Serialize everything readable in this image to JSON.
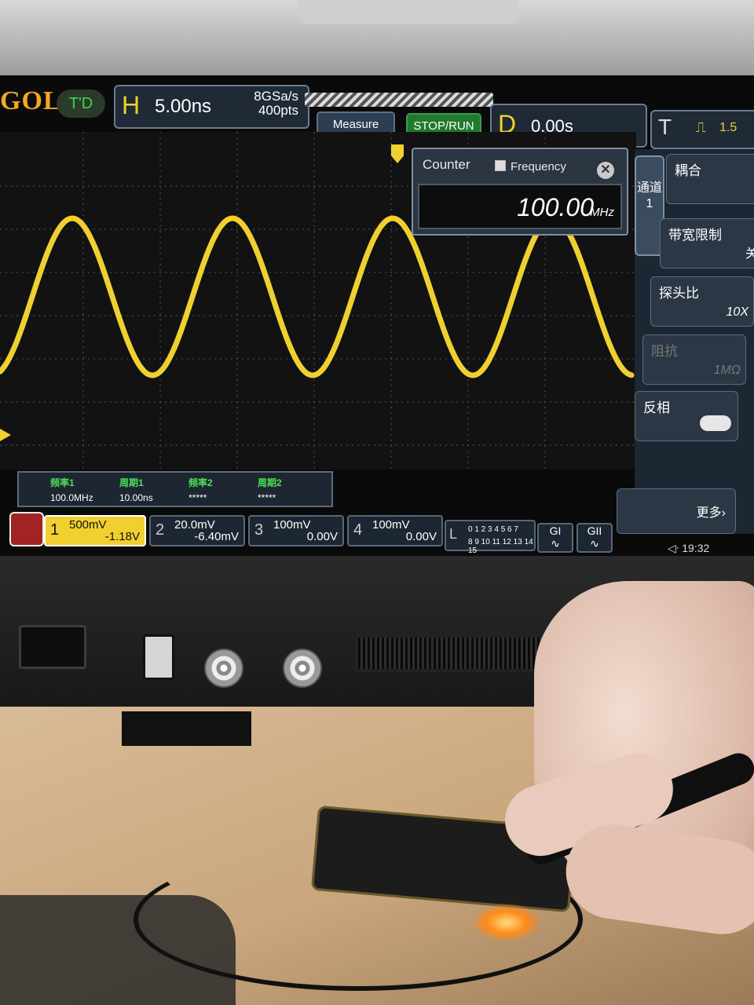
{
  "brand": "GOL",
  "topbar": {
    "td_button": "T'D",
    "horizontal": {
      "letter": "H",
      "timebase": "5.00ns",
      "sample_rate": "8GSa/s",
      "points": "400pts"
    },
    "measure_button": "Measure",
    "stop_run_button": "STOP/RUN",
    "delay": {
      "letter": "D",
      "value": "0.00s"
    },
    "trigger": {
      "letter": "T",
      "level": "1.5"
    }
  },
  "counter": {
    "title": "Counter",
    "option": "Frequency",
    "value": "100.00",
    "unit": "MHz"
  },
  "side_menu": {
    "tab": "通道1",
    "coupling": {
      "label": "耦合"
    },
    "bw_limit": {
      "label": "带宽限制",
      "value": "关"
    },
    "probe": {
      "label": "探头比",
      "value": "10X"
    },
    "impedance": {
      "label": "阻抗",
      "value": "1MΩ"
    },
    "invert": {
      "label": "反相"
    },
    "more": "更多"
  },
  "measurements": [
    {
      "name": "频率1",
      "value": "100.0MHz"
    },
    {
      "name": "周期1",
      "value": "10.00ns"
    },
    {
      "name": "频率2",
      "value": "*****"
    },
    {
      "name": "周期2",
      "value": "*****"
    }
  ],
  "channels": [
    {
      "num": "1",
      "scale": "500mV",
      "offset": "-1.18V"
    },
    {
      "num": "2",
      "scale": "20.0mV",
      "offset": "-6.40mV"
    },
    {
      "num": "3",
      "scale": "100mV",
      "offset": "0.00V"
    },
    {
      "num": "4",
      "scale": "100mV",
      "offset": "0.00V"
    }
  ],
  "logic": {
    "letter": "L",
    "row1": "0 1 2 3  4 5 6 7",
    "row2": "8 9 10 11 12 13 14 15"
  },
  "generators": [
    "GI",
    "GII"
  ],
  "clock": "19:32",
  "colors": {
    "ch1": "#f0d030",
    "accent_green": "#3bd54a",
    "measure_label": "#4ce05a"
  }
}
